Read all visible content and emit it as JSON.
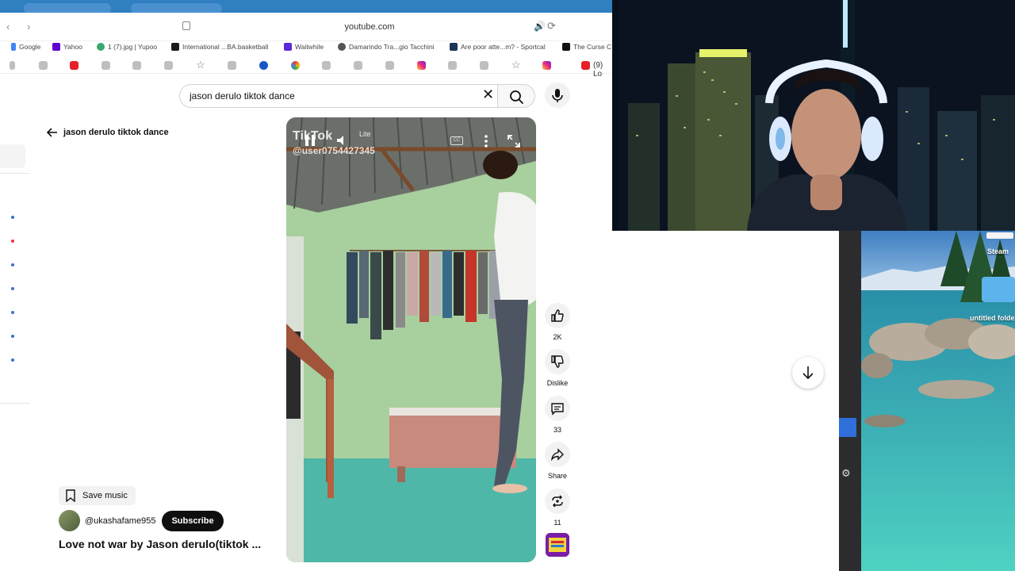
{
  "browser": {
    "url": "youtube.com",
    "bookmarks": [
      {
        "label": "Google",
        "color": "#4285f4"
      },
      {
        "label": "Yahoo",
        "color": "#6001d2"
      },
      {
        "label": "1 (7).jpg | Yupoo",
        "color": "#3aa76d"
      },
      {
        "label": "International ...BA.basketball",
        "color": "#1a1a1a"
      },
      {
        "label": "Waitwhile",
        "color": "#5b2bd6"
      },
      {
        "label": "Damarindo Tra...gio Tacchini",
        "color": "#555555"
      },
      {
        "label": "Are poor atte...m? - Sportcal",
        "color": "#1d3557"
      },
      {
        "label": "The Curse C",
        "color": "#111111"
      }
    ],
    "active_tab_label": "(9) Lo"
  },
  "youtube": {
    "search": {
      "value": "jason derulo tiktok dance",
      "placeholder": "Search"
    },
    "back_label": "jason derulo tiktok dance",
    "video": {
      "overlay_brand": "TikTok",
      "overlay_brand_suffix": "Lite",
      "overlay_user": "@user0754427345"
    },
    "actions": {
      "like_count": "2K",
      "dislike_label": "Dislike",
      "comments_count": "33",
      "share_label": "Share",
      "remix_count": "11"
    },
    "save_music_label": "Save music",
    "channel_name": "@ukashafame955",
    "subscribe_label": "Subscribe",
    "video_title": "Love not war by Jason derulo(tiktok ..."
  },
  "desktop": {
    "icons": [
      {
        "label": "Steam"
      },
      {
        "label": "untitled folde"
      }
    ]
  },
  "colors": {
    "youtube_text": "#0f0f0f",
    "subscribe_bg": "#0f0f0f",
    "browser_top": "#2f7fc1",
    "desktop_water": "#1fb3b0"
  }
}
